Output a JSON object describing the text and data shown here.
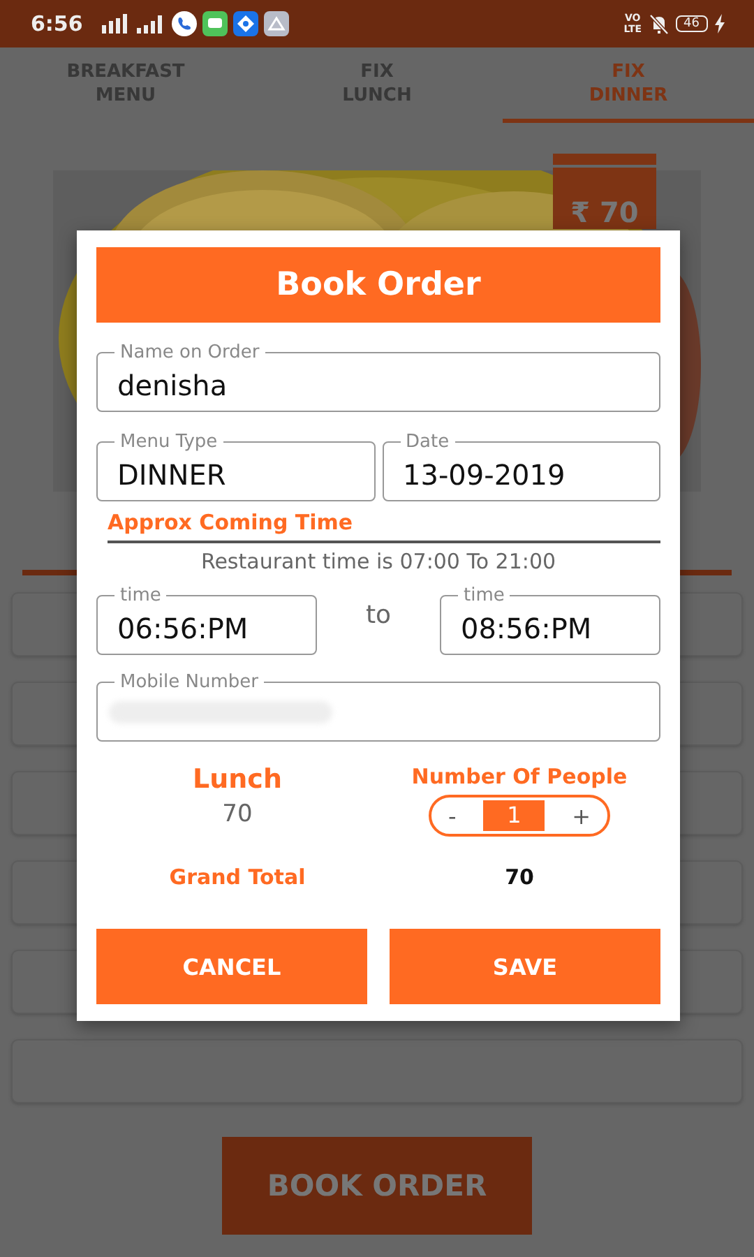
{
  "status_bar": {
    "time": "6:56",
    "network": "VO\nLTE",
    "battery": "46"
  },
  "tabs": [
    {
      "label": "BREAKFAST\nMENU",
      "selected": false
    },
    {
      "label": "FIX\nLUNCH",
      "selected": false
    },
    {
      "label": "FIX\nDINNER",
      "selected": true
    }
  ],
  "dish": {
    "kind": "picture",
    "price": "₹ 70"
  },
  "book_order_button": "BOOK ORDER",
  "dialog": {
    "title": "Book Order",
    "name_field": {
      "label": "Name on Order",
      "value": "denisha"
    },
    "menu_type_field": {
      "label": "Menu Type",
      "value": "DINNER"
    },
    "date_field": {
      "label": "Date",
      "value": "13-09-2019"
    },
    "section_title": "Approx Coming Time",
    "hours_note": "Restaurant time is 07:00 To 21:00",
    "from_time": {
      "label": "time",
      "value": "06:56:PM"
    },
    "to_label": "to",
    "to_time": {
      "label": "time",
      "value": "08:56:PM"
    },
    "mobile_field": {
      "label": "Mobile Number",
      "redacted": true
    },
    "item": {
      "label": "Lunch",
      "price": "70"
    },
    "people": {
      "label": "Number Of People",
      "minus": "-",
      "count": "1",
      "plus": "+"
    },
    "grand_total": {
      "label": "Grand Total",
      "value": "70"
    },
    "buttons": [
      "CANCEL",
      "SAVE"
    ]
  }
}
